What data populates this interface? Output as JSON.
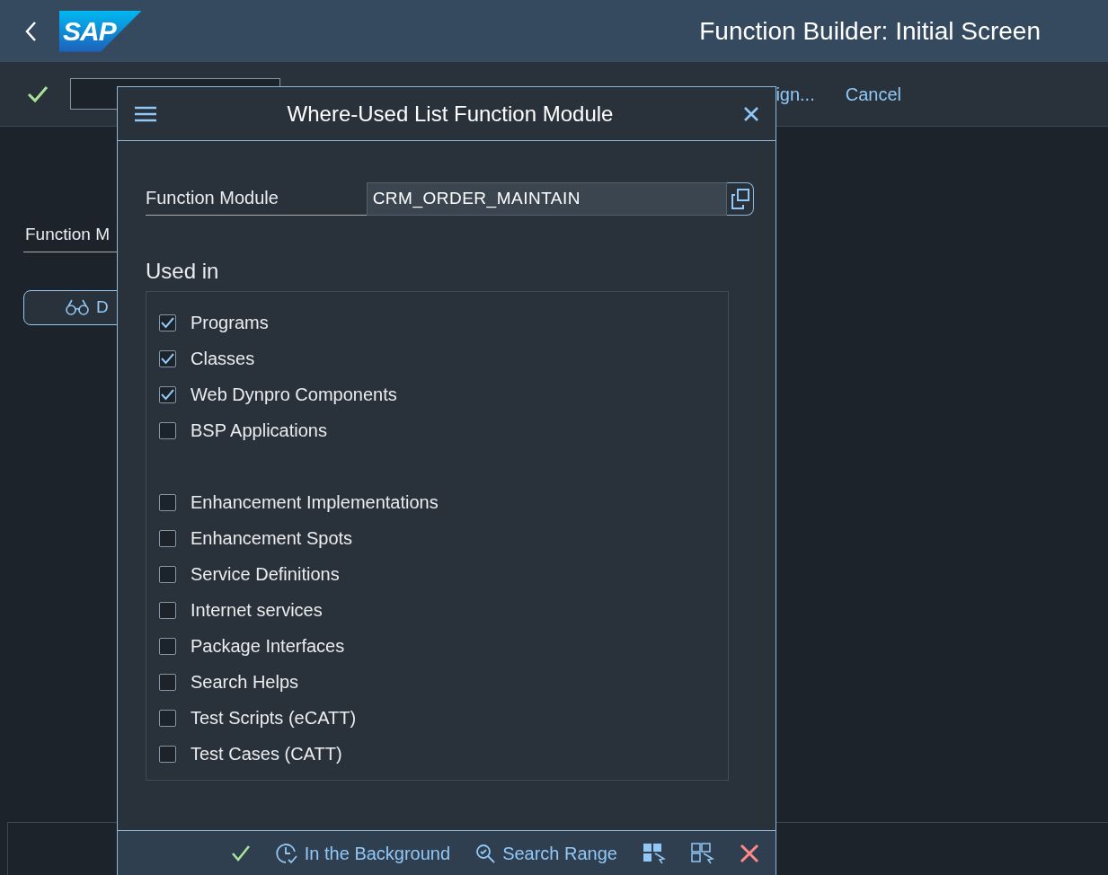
{
  "header": {
    "logo": "SAP",
    "title": "Function Builder: Initial Screen"
  },
  "toolbar": {
    "partial_button": "ign...",
    "cancel_button": "Cancel"
  },
  "main": {
    "field_label": "Function M",
    "button_label": "D"
  },
  "dialog": {
    "title": "Where-Used List Function Module",
    "field": {
      "label": "Function Module",
      "value": "CRM_ORDER_MAINTAIN"
    },
    "section_title": "Used in",
    "groups": [
      [
        {
          "label": "Programs",
          "checked": true
        },
        {
          "label": "Classes",
          "checked": true
        },
        {
          "label": "Web Dynpro Components",
          "checked": true
        },
        {
          "label": "BSP Applications",
          "checked": false
        }
      ],
      [
        {
          "label": "Enhancement Implementations",
          "checked": false
        },
        {
          "label": "Enhancement Spots",
          "checked": false
        },
        {
          "label": "Service Definitions",
          "checked": false
        },
        {
          "label": "Internet services",
          "checked": false
        },
        {
          "label": "Package Interfaces",
          "checked": false
        },
        {
          "label": "Search Helps",
          "checked": false
        },
        {
          "label": "Test Scripts (eCATT)",
          "checked": false
        },
        {
          "label": "Test Cases (CATT)",
          "checked": false
        }
      ]
    ],
    "footer_buttons": [
      {
        "kind": "confirm"
      },
      {
        "kind": "background",
        "label": "In the Background"
      },
      {
        "kind": "search",
        "label": "Search Range"
      },
      {
        "kind": "select-all"
      },
      {
        "kind": "deselect-all"
      },
      {
        "kind": "cancel"
      }
    ]
  }
}
